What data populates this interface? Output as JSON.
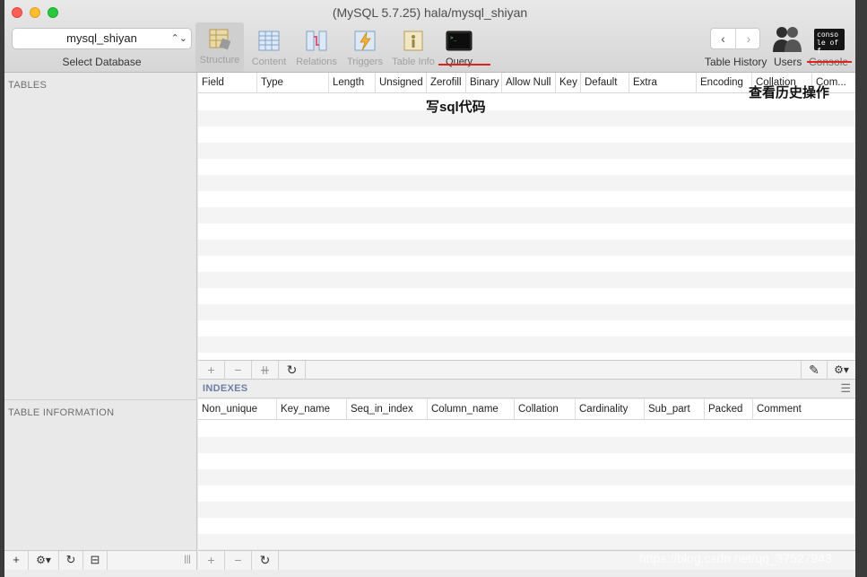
{
  "window": {
    "title": "(MySQL 5.7.25) hala/mysql_shiyan"
  },
  "database": {
    "selected": "mysql_shiyan",
    "caption": "Select Database"
  },
  "toolbar": {
    "tabs": [
      {
        "label": "Structure",
        "icon": "structure-icon"
      },
      {
        "label": "Content",
        "icon": "content-icon"
      },
      {
        "label": "Relations",
        "icon": "relations-icon"
      },
      {
        "label": "Triggers",
        "icon": "triggers-icon"
      },
      {
        "label": "Table Info",
        "icon": "table-info-icon"
      },
      {
        "label": "Query",
        "icon": "query-terminal-icon"
      }
    ],
    "table_history_label": "Table History",
    "users_label": "Users",
    "console_label": "Console",
    "console_icon_text": "conso le off"
  },
  "annotations": {
    "query_note": "写sql代码",
    "console_note": "查看历史操作"
  },
  "sidebar": {
    "tables_heading": "TABLES",
    "table_info_heading": "TABLE INFORMATION"
  },
  "structure": {
    "columns": [
      "Field",
      "Type",
      "Length",
      "Unsigned",
      "Zerofill",
      "Binary",
      "Allow Null",
      "Key",
      "Default",
      "Extra",
      "Encoding",
      "Collation",
      "Com..."
    ]
  },
  "indexes": {
    "heading": "INDEXES",
    "columns": [
      "Non_unique",
      "Key_name",
      "Seq_in_index",
      "Column_name",
      "Collation",
      "Cardinality",
      "Sub_part",
      "Packed",
      "Comment"
    ]
  },
  "buttons": {
    "add": "+",
    "remove": "−",
    "duplicate": "⧺",
    "refresh": "↻",
    "edit": "✎",
    "gear": "⚙▾",
    "menu": "☰",
    "split": "|||",
    "filter": "⊟"
  },
  "watermark": "https://blog.csdn.net/qq_37527943",
  "colors": {
    "accent_red": "#e4201f",
    "indexes_heading": "#6a7fa0"
  }
}
